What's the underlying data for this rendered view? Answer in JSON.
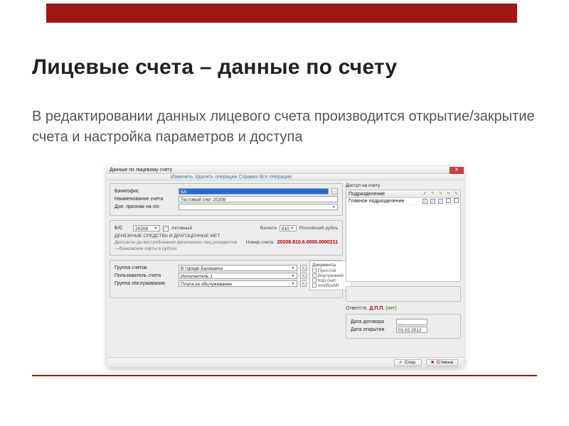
{
  "slide": {
    "title": "Лицевые счета – данные по счету",
    "subtitle": "В редактировании данных лицевого счета производится открытие/закрытие счета и настройка параметров и доступа"
  },
  "window": {
    "title": "Данные по лицевому счету",
    "toolbar": "Изменить    Удалить операции    Справка    Все операции",
    "close_glyph": "✕",
    "labels": {
      "bank_office": "Банк/офис",
      "account_name": "Наименование счета",
      "contract": "Доп. признак на л/с",
      "bs": "Б/С",
      "active": "Активный",
      "currency": "Валюта",
      "section_title": "ДЕНЕЖНЫЕ СРЕДСТВА И ДРАГОЦЕННЫЕ МЕТ",
      "section_sub": "Депозиты до востребования физических лиц резидентов",
      "section_sub2": "—банковские карты в рублях",
      "acc_no_label": "Номер счета:",
      "acc_group": "Группа счетов",
      "acc_user": "Пользователь счета",
      "serv_group": "Группа обслуживания",
      "documents": "Документы",
      "date_contract": "Дата договора",
      "date_open": "Дата открытия"
    },
    "values": {
      "bank_office": "БА",
      "account_name": "Тестовый счет 20208",
      "contract": "",
      "bs": "20208",
      "currency_code": "810",
      "currency_name": "Российский рубль",
      "acc_number": "20208.810.6.0000.0000211",
      "acc_group": "В городе Балашиха",
      "acc_user": "Исполнитель 1",
      "serv_group": "Плата за обслуживание",
      "date_contract": " . .",
      "date_open": "01.02.2012"
    },
    "docs": [
      "Простой",
      "Внутренний",
      "Кор.счет",
      "vmrBoxMI"
    ],
    "access": {
      "title": "Доступ на счету",
      "cols": [
        "Подразделение",
        "✓",
        "✎",
        "✎",
        "✂",
        "✎"
      ],
      "rows": [
        {
          "name": "Главное подразделение",
          "flags": [
            true,
            true,
            true,
            false,
            false
          ]
        }
      ]
    },
    "owner": {
      "label": "Ответств.",
      "name": "Д.П.П.",
      "hint": "(нет)"
    },
    "buttons": {
      "ok": "Сохр.",
      "cancel": "Отмена"
    }
  }
}
